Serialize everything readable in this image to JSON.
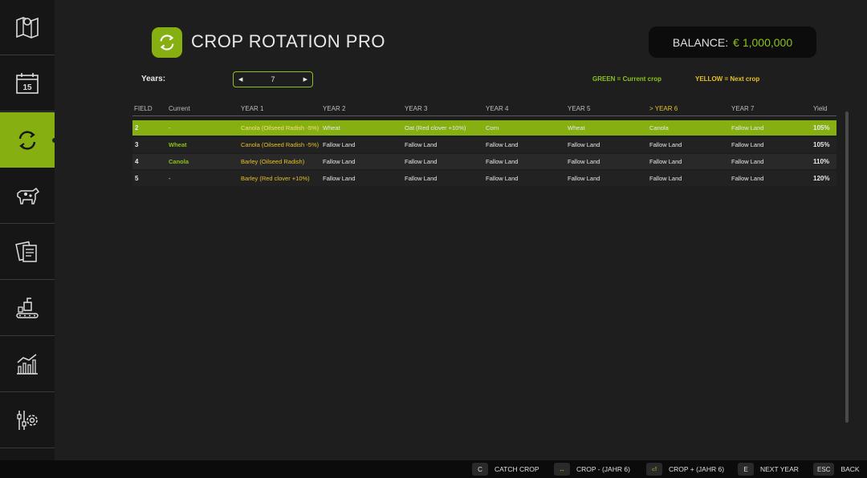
{
  "sidebar": {
    "items": [
      {
        "icon": "map-icon"
      },
      {
        "icon": "calendar-icon",
        "label": "15"
      },
      {
        "icon": "rotation-icon",
        "active": true
      },
      {
        "icon": "cow-icon"
      },
      {
        "icon": "contracts-icon"
      },
      {
        "icon": "production-icon"
      },
      {
        "icon": "stats-icon"
      },
      {
        "icon": "settings-icon"
      }
    ]
  },
  "header": {
    "title": "CROP ROTATION PRO",
    "balance_label": "BALANCE:",
    "balance_value": "€ 1,000,000"
  },
  "controls": {
    "years_label": "Years:",
    "years_value": "7",
    "legend_green": "GREEN = Current crop",
    "legend_yellow": "YELLOW = Next crop"
  },
  "colors": {
    "accent": "#86b012",
    "green_text": "#8cc21a",
    "yellow_text": "#e6c229"
  },
  "table": {
    "headers": [
      "FIELD",
      "Current",
      "YEAR 1",
      "YEAR 2",
      "YEAR 3",
      "YEAR 4",
      "YEAR 5",
      "> YEAR 6",
      "YEAR 7",
      "Yield"
    ],
    "rows": [
      [
        "2",
        "-",
        "Canola (Oilseed Radish -5%)",
        "Wheat",
        "Oat (Red clover +10%)",
        "Corn",
        "Wheat",
        "Canola",
        "Fallow Land",
        "105%"
      ],
      [
        "3",
        "Wheat",
        "Canola (Oilseed Radish -5%)",
        "Fallow Land",
        "Fallow Land",
        "Fallow Land",
        "Fallow Land",
        "Fallow Land",
        "Fallow Land",
        "105%"
      ],
      [
        "4",
        "Canola",
        "Barley (Oilseed Radish)",
        "Fallow Land",
        "Fallow Land",
        "Fallow Land",
        "Fallow Land",
        "Fallow Land",
        "Fallow Land",
        "110%"
      ],
      [
        "5",
        "-",
        "Barley (Red clover +10%)",
        "Fallow Land",
        "Fallow Land",
        "Fallow Land",
        "Fallow Land",
        "Fallow Land",
        "Fallow Land",
        "120%"
      ]
    ]
  },
  "footer": {
    "buttons": [
      {
        "key": "C",
        "label": "CATCH CROP"
      },
      {
        "key": "↔",
        "label": "CROP - (JAHR 6)"
      },
      {
        "key": "⏎",
        "label": "CROP + (JAHR 6)"
      },
      {
        "key": "E",
        "label": "NEXT YEAR"
      },
      {
        "key": "ESC",
        "label": "BACK"
      }
    ]
  }
}
